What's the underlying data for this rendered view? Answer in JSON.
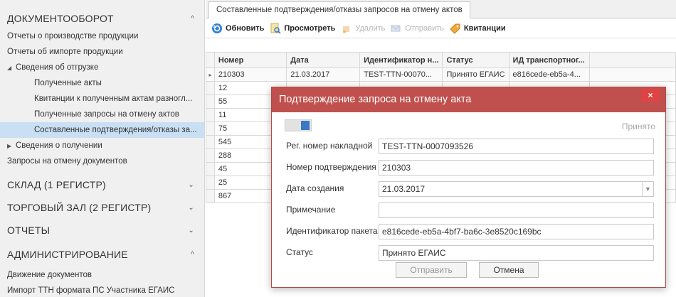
{
  "sidebar": {
    "doc_section": "ДОКУМЕНТООБОРОТ",
    "items": [
      "Отчеты о производстве продукции",
      "Отчеты об импорте продукции",
      "Сведения об отгрузке",
      "Полученные акты",
      "Квитанции к полученным актам разногл...",
      "Полученные запросы на отмену актов",
      "Составленные подтверждения/отказы за...",
      "Сведения о получении",
      "Запросы на отмену документов"
    ],
    "sections": [
      "СКЛАД (1 РЕГИСТР)",
      "ТОРГОВЫЙ ЗАЛ (2 РЕГИСТР)",
      "ОТЧЕТЫ",
      "АДМИНИСТРИРОВАНИЕ"
    ],
    "admin_items": [
      "Движение документов",
      "Импорт ТТН формата ПС Участника ЕГАИС"
    ]
  },
  "tab": {
    "label": "Составленные подтверждения/отказы запросов на отмену актов"
  },
  "toolbar": {
    "refresh": "Обновить",
    "view": "Просмотреть",
    "delete": "Удалить",
    "send": "Отправить",
    "receipts": "Квитанции"
  },
  "grid": {
    "headers": [
      "Номер",
      "Дата",
      "Идентификатор н...",
      "Статус",
      "ИД транспортног..."
    ],
    "first_row": [
      "210303",
      "21.03.2017",
      "TEST-TTN-00070...",
      "Принято ЕГАИС",
      "e816cede-eb5a-4..."
    ],
    "numbers": [
      "12",
      "55",
      "11",
      "75",
      "545",
      "288",
      "45",
      "25",
      "867"
    ]
  },
  "modal": {
    "title": "Подтверждение запроса на отмену акта",
    "status_top": "Принято",
    "fields": [
      {
        "label": "Рег. номер накладной",
        "value": "TEST-TTN-0007093526"
      },
      {
        "label": "Номер подтверждения",
        "value": "210303"
      },
      {
        "label": "Дата создания",
        "value": "21.03.2017"
      },
      {
        "label": "Примечание",
        "value": ""
      },
      {
        "label": "Идентификатор пакета",
        "value": "e816cede-eb5a-4bf7-ba6c-3e8520c169bc"
      },
      {
        "label": "Статус",
        "value": "Принято ЕГАИС"
      }
    ],
    "send_button": "Отправить",
    "cancel_button": "Отмена",
    "close_glyph": "×"
  },
  "colors": {
    "modal_title_bg": "#c0504d",
    "close_bg": "#e04343",
    "selected_sidebar": "#c9dff3",
    "toggle_accent": "#3a78c3"
  }
}
